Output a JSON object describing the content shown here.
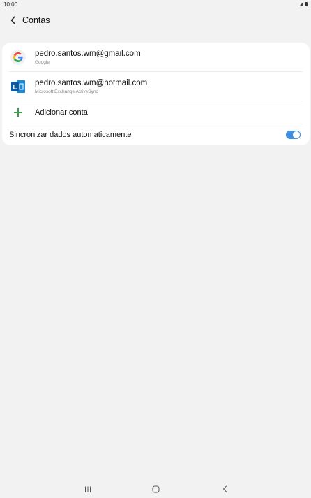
{
  "status_bar": {
    "time": "10:00"
  },
  "header": {
    "title": "Contas",
    "back_icon": "chevron-left-icon"
  },
  "accounts": [
    {
      "email": "pedro.santos.wm@gmail.com",
      "provider": "Google",
      "icon": "google-icon"
    },
    {
      "email": "pedro.santos.wm@hotmail.com",
      "provider": "Microsoft Exchange ActiveSync",
      "icon": "exchange-icon"
    }
  ],
  "add_account": {
    "label": "Adicionar conta",
    "icon": "plus-icon"
  },
  "sync": {
    "label": "Sincronizar dados automaticamente",
    "enabled": true
  },
  "nav_bar": {
    "recents_icon": "recents-icon",
    "home_icon": "home-icon",
    "back_icon": "back-icon"
  },
  "colors": {
    "background": "#f2f2f2",
    "card": "#ffffff",
    "accent": "#3e8fe0",
    "plus": "#3b9a4a",
    "exchange": "#0f6cbd"
  }
}
